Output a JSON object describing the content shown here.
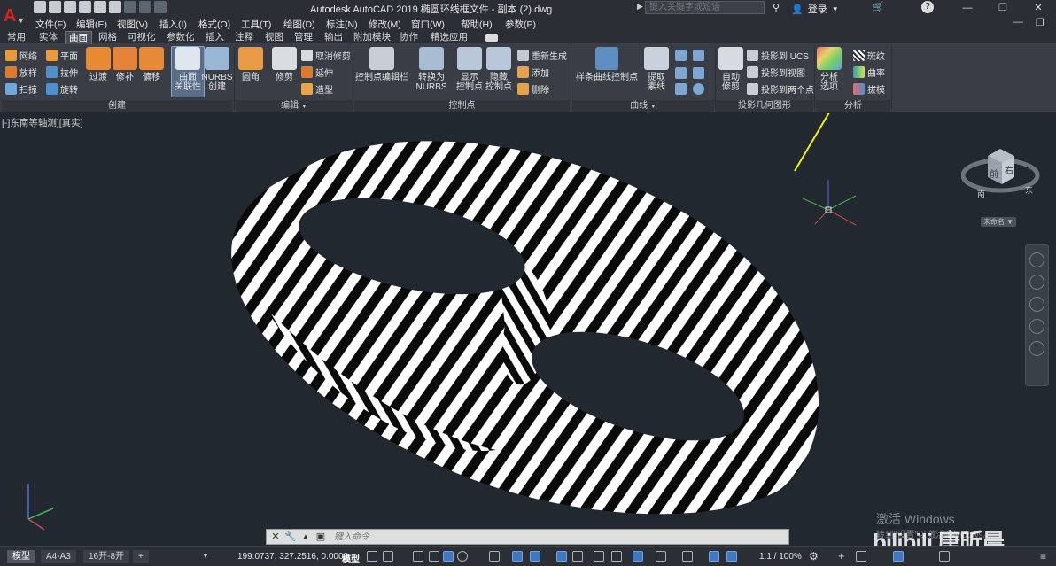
{
  "titlebar": {
    "title": "Autodesk AutoCAD 2019    椭圆环线框文件 - 副本 (2).dwg",
    "search_placeholder": "键入关键字或短语",
    "login": "登录"
  },
  "menu": [
    "文件(F)",
    "编辑(E)",
    "视图(V)",
    "插入(I)",
    "格式(O)",
    "工具(T)",
    "绘图(D)",
    "标注(N)",
    "修改(M)",
    "窗口(W)",
    "帮助(H)",
    "参数(P)"
  ],
  "tabs": [
    "常用",
    "实体",
    "曲面",
    "网格",
    "可视化",
    "参数化",
    "插入",
    "注释",
    "视图",
    "管理",
    "输出",
    "附加模块",
    "协作",
    "精选应用"
  ],
  "active_tab": "曲面",
  "ribbon": {
    "create": {
      "title": "创建",
      "small": [
        "网络",
        "放样",
        "扫掠",
        "平面",
        "拉伸",
        "旋转"
      ],
      "big": [
        "过渡",
        "修补",
        "偏移"
      ],
      "assoc": [
        "曲面",
        "关联性"
      ],
      "nurbs": [
        "NURBS",
        "创建"
      ]
    },
    "edit": {
      "title": "编辑",
      "fillet": "圆角",
      "trim": "修剪",
      "small": [
        "取消修剪",
        "延伸",
        "造型"
      ]
    },
    "cv": {
      "title": "控制点",
      "editbar": "控制点编辑栏",
      "convert": [
        "转换为",
        "NURBS"
      ],
      "show": [
        "显示",
        "控制点"
      ],
      "hide": [
        "隐藏",
        "控制点"
      ],
      "small": [
        "重新生成",
        "添加",
        "删除"
      ]
    },
    "curves": {
      "title": "曲线",
      "spline": "样条曲线控制点",
      "extract": [
        "提取",
        "素线"
      ]
    },
    "project": {
      "title": "投影几何图形",
      "auto": [
        "自动",
        "修剪"
      ],
      "small": [
        "投影到 UCS",
        "投影到视图",
        "投影到两个点"
      ]
    },
    "analysis": {
      "title": "分析",
      "options": [
        "分析",
        "选项"
      ],
      "small": [
        "斑纹",
        "曲率",
        "拔模"
      ]
    }
  },
  "viewport": {
    "label": "[-]东南等轴测][真实]",
    "viewcube_front": "前",
    "viewcube_right": "右",
    "viewcube_top": "上",
    "compass_s": "南",
    "compass_e": "东",
    "wcs": "未命名"
  },
  "statusbar": {
    "layouts": [
      "模型",
      "A4-A3",
      "16开-8开"
    ],
    "add": "+",
    "coords": "199.0737, 327.2516, 0.0000",
    "model": "模型",
    "scale": "1:1 / 100%"
  },
  "cmdline": {
    "placeholder": "键入命令"
  },
  "watermark": {
    "activate": "激活 Windows",
    "activate_sub": "转到\"设置\"以激活 Windows。",
    "bili": "bilibili 唐昕晨"
  },
  "colors": {
    "accent": "#3d78c2",
    "background": "#212830",
    "ribbon": "#393e46",
    "logo": "#d9221c",
    "arrow": "#f2f20a"
  }
}
